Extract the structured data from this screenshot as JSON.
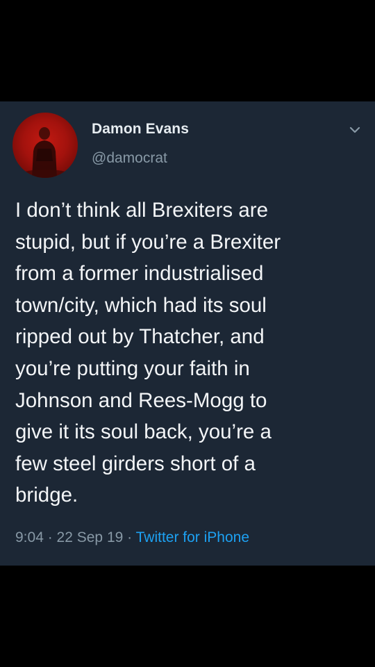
{
  "tweet": {
    "display_name": "Damon Evans",
    "handle": "@damocrat",
    "menu_icon": "chevron-down-icon",
    "text": "I don’t think all Brexiters are\nstupid, but if you’re a Brexiter\nfrom a former industrialised\ntown/city,  which had its soul\nripped out by Thatcher, and\nyou’re putting your faith in\nJohnson and Rees-Mogg to\ngive it its soul back, you’re a\nfew steel girders short of a\nbridge.",
    "time": "9:04",
    "separator": " · ",
    "date": "22 Sep 19",
    "source": "Twitter for iPhone"
  },
  "colors": {
    "background": "#000000",
    "card": "#1c2735",
    "text": "#f3f5f7",
    "secondary_text": "#8899a6",
    "link": "#1da1f2",
    "avatar": "#b5160f"
  }
}
